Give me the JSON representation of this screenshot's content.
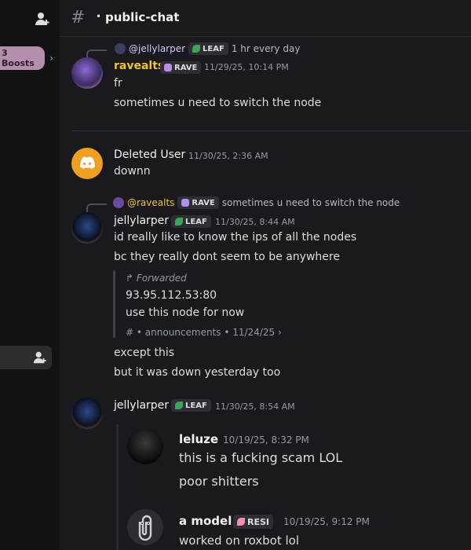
{
  "sidebar": {
    "boosts_label": "3 Boosts",
    "add_user_icon": "person-add-icon"
  },
  "header": {
    "hash": "#",
    "dot": "•",
    "channel_name": "public-chat"
  },
  "messages": [
    {
      "reply": {
        "mention": "@jellylarper",
        "tag": "LEAF",
        "text": "1 hr every day"
      },
      "author": "ravealts",
      "author_color": "#f0c330",
      "tag": "RAVE",
      "tag_color": "#b48ef0",
      "timestamp": "11/29/25, 10:14 PM",
      "lines": [
        "fr",
        "sometimes u need to switch the node"
      ]
    },
    {
      "author": "Deleted User",
      "author_color": "#f2f3f5",
      "timestamp": "11/30/25, 2:36 AM",
      "lines": [
        "downn"
      ]
    },
    {
      "reply": {
        "mention": "@ravealts",
        "tag": "RAVE",
        "text": "sometimes u need to switch the node"
      },
      "author": "jellylarper",
      "author_color": "#f2f3f5",
      "tag": "LEAF",
      "tag_color": "#3ba55d",
      "timestamp": "11/30/25, 8:44 AM",
      "lines": [
        "id really like to know the ips of all the nodes",
        "bc they really dont seem to be anywhere"
      ],
      "forward": {
        "label": "Forwarded",
        "lines": [
          "93.95.112.53:80",
          "use this node for now"
        ],
        "source_hash": "#",
        "source_channel": "announcements",
        "source_date": "11/24/25",
        "chevron": "›"
      },
      "after_lines": [
        "except this",
        "but it was down yesterday too"
      ]
    },
    {
      "author": "jellylarper",
      "author_color": "#f2f3f5",
      "tag": "LEAF",
      "tag_color": "#3ba55d",
      "timestamp": "11/30/25, 8:54 AM"
    }
  ],
  "nested": [
    {
      "author": "leluze",
      "timestamp": "10/19/25, 8:32 PM",
      "lines": [
        "this is a fucking scam LOL",
        "poor shitters"
      ]
    },
    {
      "author": "a model",
      "tag": "RESI",
      "tag_color": "#f48fb1",
      "timestamp": "10/19/25, 9:12 PM",
      "lines": [
        "worked on roxbot lol"
      ]
    }
  ]
}
